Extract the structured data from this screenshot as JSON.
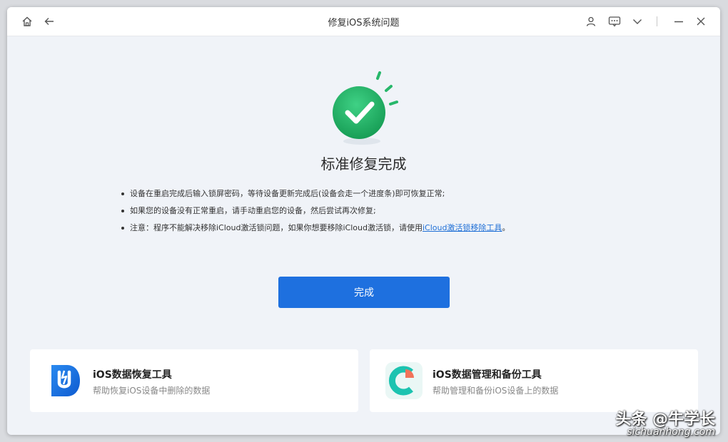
{
  "window": {
    "title": "修复iOS系统问题"
  },
  "main": {
    "heading": "标准修复完成",
    "notes": [
      {
        "text": "设备在重启完成后输入锁屏密码，等待设备更新完成后(设备会走一个进度条)即可恢复正常;"
      },
      {
        "text": "如果您的设备没有正常重启，请手动重启您的设备，然后尝试再次修复;"
      },
      {
        "text_before": "注意：程序不能解决移除iCloud激活锁问题，如果你想要移除iCloud激活锁，请使用",
        "link": "iCloud激活锁移除工具",
        "text_after": "。"
      }
    ],
    "done_label": "完成"
  },
  "cards": [
    {
      "title": "iOS数据恢复工具",
      "subtitle": "帮助恢复iOS设备中删除的数据"
    },
    {
      "title": "iOS数据管理和备份工具",
      "subtitle": "帮助管理和备份iOS设备上的数据"
    }
  ],
  "watermark": {
    "line1": "头条 @牛学长",
    "line2": "sichuanhong.com"
  },
  "colors": {
    "accent": "#1e70df",
    "success": "#27b76a",
    "background": "#f0f3f8",
    "link": "#1f6fd6"
  }
}
